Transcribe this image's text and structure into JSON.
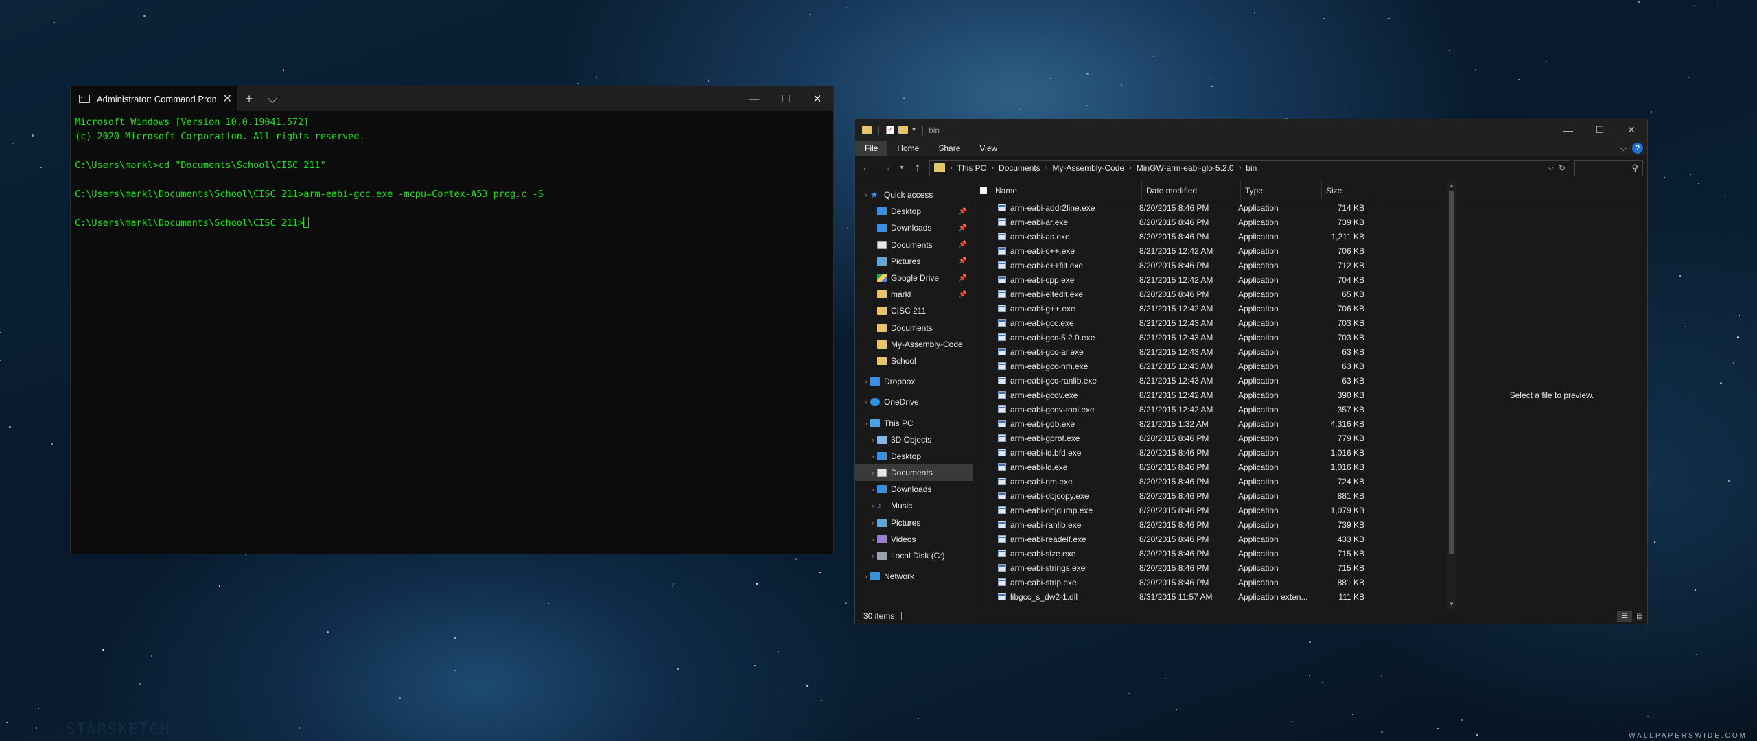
{
  "terminal": {
    "tab_title": "Administrator: Command Promp",
    "close": "✕",
    "new_tab": "+",
    "dropdown": "⌵",
    "lines": [
      "Microsoft Windows [Version 10.0.19041.572]",
      "(c) 2020 Microsoft Corporation. All rights reserved.",
      "",
      "C:\\Users\\markl>cd \"Documents\\School\\CISC 211\"",
      "",
      "C:\\Users\\markl\\Documents\\School\\CISC 211>arm-eabi-gcc.exe -mcpu=Cortex-A53 prog.c -S",
      "",
      "C:\\Users\\markl\\Documents\\School\\CISC 211>"
    ]
  },
  "window_controls": {
    "minimize": "—",
    "maximize": "☐",
    "close": "✕"
  },
  "explorer": {
    "title": "bin",
    "ribbon_tabs": [
      "File",
      "Home",
      "Share",
      "View"
    ],
    "help": "?",
    "expand": "⌵",
    "address": {
      "crumbs": [
        "This PC",
        "Documents",
        "My-Assembly-Code",
        "MinGW-arm-eabi-glo-5.2.0",
        "bin"
      ],
      "separator": "›"
    },
    "search_icon": "⚲",
    "nav": {
      "quick_access": "Quick access",
      "items": [
        {
          "label": "Desktop",
          "icon": "blue",
          "pinned": true
        },
        {
          "label": "Downloads",
          "icon": "blue",
          "pinned": true
        },
        {
          "label": "Documents",
          "icon": "doc",
          "pinned": true
        },
        {
          "label": "Pictures",
          "icon": "pic",
          "pinned": true
        },
        {
          "label": "Google Drive",
          "icon": "gd",
          "pinned": true
        },
        {
          "label": "markl",
          "icon": "folder",
          "pinned": true
        },
        {
          "label": "CISC 211",
          "icon": "folder",
          "pinned": false
        },
        {
          "label": "Documents",
          "icon": "folder",
          "pinned": false
        },
        {
          "label": "My-Assembly-Code",
          "icon": "folder",
          "pinned": false
        },
        {
          "label": "School",
          "icon": "folder",
          "pinned": false
        }
      ],
      "dropbox": "Dropbox",
      "onedrive": "OneDrive",
      "this_pc": "This PC",
      "pc_items": [
        {
          "label": "3D Objects",
          "icon": "cube"
        },
        {
          "label": "Desktop",
          "icon": "blue"
        },
        {
          "label": "Documents",
          "icon": "doc",
          "selected": true
        },
        {
          "label": "Downloads",
          "icon": "blue"
        },
        {
          "label": "Music",
          "icon": "music"
        },
        {
          "label": "Pictures",
          "icon": "pic"
        },
        {
          "label": "Videos",
          "icon": "video"
        },
        {
          "label": "Local Disk (C:)",
          "icon": "disk"
        }
      ],
      "network": "Network"
    },
    "columns": {
      "name": "Name",
      "date": "Date modified",
      "type": "Type",
      "size": "Size"
    },
    "files": [
      {
        "name": "arm-eabi-addr2line.exe",
        "date": "8/20/2015 8:46 PM",
        "type": "Application",
        "size": "714 KB"
      },
      {
        "name": "arm-eabi-ar.exe",
        "date": "8/20/2015 8:46 PM",
        "type": "Application",
        "size": "739 KB"
      },
      {
        "name": "arm-eabi-as.exe",
        "date": "8/20/2015 8:46 PM",
        "type": "Application",
        "size": "1,211 KB"
      },
      {
        "name": "arm-eabi-c++.exe",
        "date": "8/21/2015 12:42 AM",
        "type": "Application",
        "size": "706 KB"
      },
      {
        "name": "arm-eabi-c++filt.exe",
        "date": "8/20/2015 8:46 PM",
        "type": "Application",
        "size": "712 KB"
      },
      {
        "name": "arm-eabi-cpp.exe",
        "date": "8/21/2015 12:42 AM",
        "type": "Application",
        "size": "704 KB"
      },
      {
        "name": "arm-eabi-elfedit.exe",
        "date": "8/20/2015 8:46 PM",
        "type": "Application",
        "size": "65 KB"
      },
      {
        "name": "arm-eabi-g++.exe",
        "date": "8/21/2015 12:42 AM",
        "type": "Application",
        "size": "706 KB"
      },
      {
        "name": "arm-eabi-gcc.exe",
        "date": "8/21/2015 12:43 AM",
        "type": "Application",
        "size": "703 KB"
      },
      {
        "name": "arm-eabi-gcc-5.2.0.exe",
        "date": "8/21/2015 12:43 AM",
        "type": "Application",
        "size": "703 KB"
      },
      {
        "name": "arm-eabi-gcc-ar.exe",
        "date": "8/21/2015 12:43 AM",
        "type": "Application",
        "size": "63 KB"
      },
      {
        "name": "arm-eabi-gcc-nm.exe",
        "date": "8/21/2015 12:43 AM",
        "type": "Application",
        "size": "63 KB"
      },
      {
        "name": "arm-eabi-gcc-ranlib.exe",
        "date": "8/21/2015 12:43 AM",
        "type": "Application",
        "size": "63 KB"
      },
      {
        "name": "arm-eabi-gcov.exe",
        "date": "8/21/2015 12:42 AM",
        "type": "Application",
        "size": "390 KB"
      },
      {
        "name": "arm-eabi-gcov-tool.exe",
        "date": "8/21/2015 12:42 AM",
        "type": "Application",
        "size": "357 KB"
      },
      {
        "name": "arm-eabi-gdb.exe",
        "date": "8/21/2015 1:32 AM",
        "type": "Application",
        "size": "4,316 KB"
      },
      {
        "name": "arm-eabi-gprof.exe",
        "date": "8/20/2015 8:46 PM",
        "type": "Application",
        "size": "779 KB"
      },
      {
        "name": "arm-eabi-ld.bfd.exe",
        "date": "8/20/2015 8:46 PM",
        "type": "Application",
        "size": "1,016 KB"
      },
      {
        "name": "arm-eabi-ld.exe",
        "date": "8/20/2015 8:46 PM",
        "type": "Application",
        "size": "1,016 KB"
      },
      {
        "name": "arm-eabi-nm.exe",
        "date": "8/20/2015 8:46 PM",
        "type": "Application",
        "size": "724 KB"
      },
      {
        "name": "arm-eabi-objcopy.exe",
        "date": "8/20/2015 8:46 PM",
        "type": "Application",
        "size": "881 KB"
      },
      {
        "name": "arm-eabi-objdump.exe",
        "date": "8/20/2015 8:46 PM",
        "type": "Application",
        "size": "1,079 KB"
      },
      {
        "name": "arm-eabi-ranlib.exe",
        "date": "8/20/2015 8:46 PM",
        "type": "Application",
        "size": "739 KB"
      },
      {
        "name": "arm-eabi-readelf.exe",
        "date": "8/20/2015 8:46 PM",
        "type": "Application",
        "size": "433 KB"
      },
      {
        "name": "arm-eabi-size.exe",
        "date": "8/20/2015 8:46 PM",
        "type": "Application",
        "size": "715 KB"
      },
      {
        "name": "arm-eabi-strings.exe",
        "date": "8/20/2015 8:46 PM",
        "type": "Application",
        "size": "715 KB"
      },
      {
        "name": "arm-eabi-strip.exe",
        "date": "8/20/2015 8:46 PM",
        "type": "Application",
        "size": "881 KB"
      },
      {
        "name": "libgcc_s_dw2-1.dll",
        "date": "8/31/2015 11:57 AM",
        "type": "Application exten...",
        "size": "111 KB"
      }
    ],
    "preview_text": "Select a file to preview.",
    "status_items": "30 items"
  },
  "wallpaper": {
    "watermark": "WALLPAPERSWIDE.COM",
    "ghost_text": "STARSKETCH"
  },
  "colors": {
    "terminal_text": "#13e813",
    "explorer_bg": "#191919",
    "folder": "#e8c46a",
    "accent": "#3b8fe0"
  }
}
